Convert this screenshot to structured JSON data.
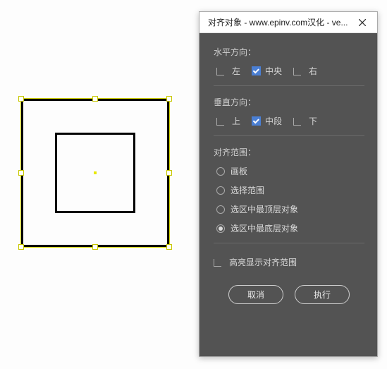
{
  "dialog": {
    "title": "对齐对象 - www.epinv.com汉化 - ve...",
    "horizontal": {
      "label": "水平方向：",
      "left": "左",
      "center": "中央",
      "right": "右",
      "checked": "center"
    },
    "vertical": {
      "label": "垂直方向：",
      "top": "上",
      "middle": "中段",
      "bottom": "下",
      "checked": "middle"
    },
    "scope": {
      "label": "对齐范围：",
      "options": [
        "画板",
        "选择范围",
        "选区中最顶层对象",
        "选区中最底层对象"
      ],
      "selected": 3
    },
    "highlight": "高亮显示对齐范围",
    "cancel": "取消",
    "execute": "执行"
  }
}
